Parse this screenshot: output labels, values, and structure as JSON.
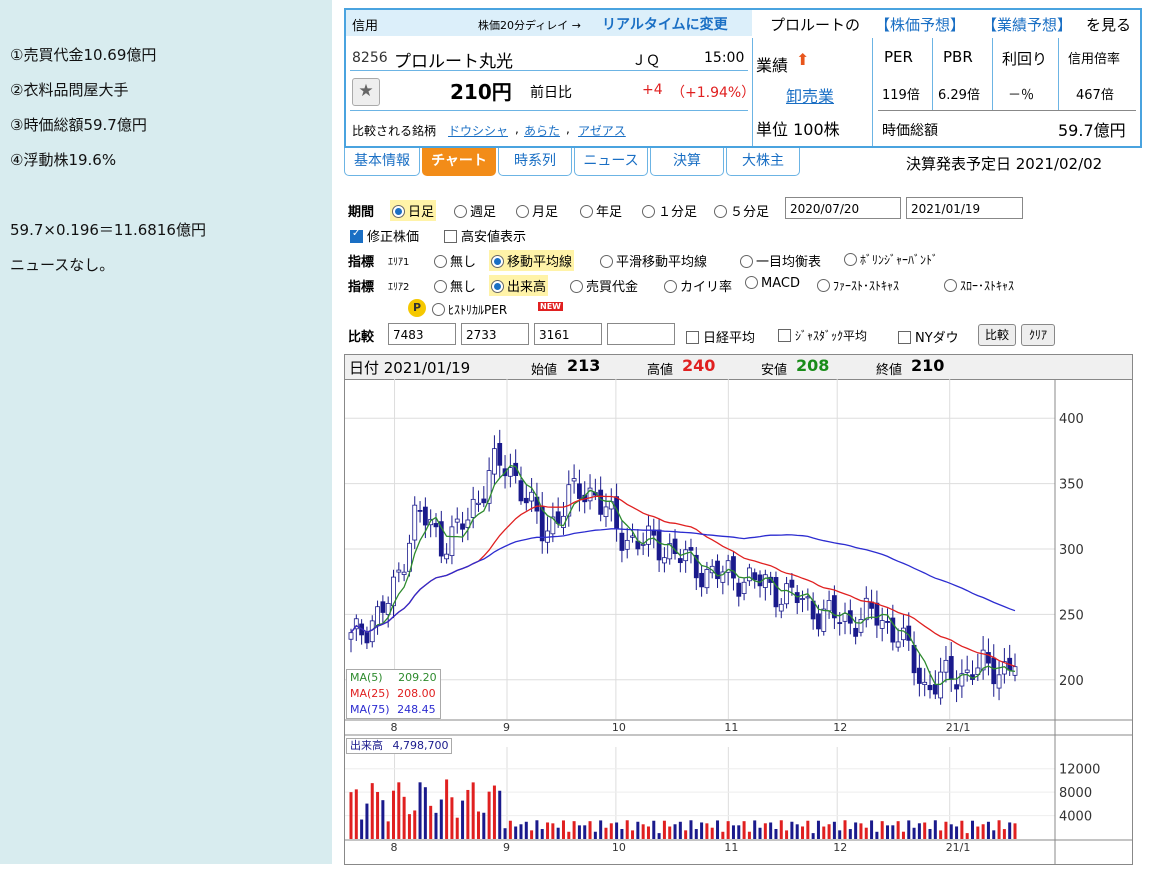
{
  "notes": [
    "①売買代金10.69億円",
    "②衣料品問屋大手",
    "③時価総額59.7億円",
    "④浮動株19.6%",
    "59.7×0.196＝11.6816億円",
    "ニュースなし。"
  ],
  "header": {
    "margin_label": "信用",
    "delay_text": "株価20分ディレイ →",
    "realtime_link": "リアルタイムに変更",
    "company_link_prefix": "プロルートの",
    "price_forecast_link": "【株価予想】",
    "earnings_forecast_link": "【業績予想】",
    "company_link_suffix": "を見る"
  },
  "stock": {
    "code": "8256",
    "name": "プロルート丸光",
    "market": "ＪＱ",
    "time": "15:00",
    "price": "210円",
    "change_label": "前日比",
    "change": "+4",
    "change_pct": "（+1.94%）",
    "compare_label": "比較される銘柄",
    "compare_stocks": [
      "ドウシシャ",
      "あらた",
      "アゼアス"
    ],
    "performance_label": "業績",
    "sector": "卸売業",
    "unit": "単位 100株",
    "metrics_headers": [
      "PER",
      "PBR",
      "利回り",
      "信用倍率"
    ],
    "metrics_values": [
      "119倍",
      "6.29倍",
      "－％",
      "467倍"
    ],
    "market_cap_label": "時価総額",
    "market_cap": "59.7億円"
  },
  "tabs": [
    "基本情報",
    "チャート",
    "時系列",
    "ニュース",
    "決算",
    "大株主"
  ],
  "earnings_date": "決算発表予定日 2021/02/02",
  "controls": {
    "period_label": "期間",
    "periods": [
      "日足",
      "週足",
      "月足",
      "年足",
      "１分足",
      "５分足"
    ],
    "date_from": "2020/07/20",
    "date_to": "2021/01/19",
    "adjusted": "修正株価",
    "high_low": "高安値表示",
    "indicator_label": "指標",
    "area1_label": "ｴﾘｱ1",
    "area1_opts": [
      "無し",
      "移動平均線",
      "平滑移動平均線",
      "一目均衡表",
      "ﾎﾞﾘﾝｼﾞｬｰﾊﾞﾝﾄﾞ"
    ],
    "area2_label": "ｴﾘｱ2",
    "area2_opts": [
      "無し",
      "出来高",
      "売買代金",
      "カイリ率",
      "MACD",
      "ﾌｧｰｽﾄ･ｽﾄｷｬｽ",
      "ｽﾛｰ･ｽﾄｷｬｽ"
    ],
    "historical_per": "ﾋｽﾄﾘｶﾙPER",
    "new_badge": "NEW",
    "p_badge": "P",
    "compare_label": "比較",
    "compare_codes": [
      "7483",
      "2733",
      "3161",
      ""
    ],
    "nikkei": "日経平均",
    "jasdaq": "ｼﾞｬｽﾀﾞｯｸ平均",
    "ny": "NYダウ",
    "compare_btn": "比較",
    "clear_btn": "ｸﾘｱ"
  },
  "ohlc": {
    "date_label": "日付 2021/01/19",
    "open_label": "始値",
    "open": "213",
    "high_label": "高値",
    "high": "240",
    "low_label": "安値",
    "low": "208",
    "close_label": "終値",
    "close": "210"
  },
  "ma_legend": [
    {
      "label": "MA(5)",
      "value": "209.20",
      "color": "#2e8b2e"
    },
    {
      "label": "MA(25)",
      "value": "208.00",
      "color": "#e02020"
    },
    {
      "label": "MA(75)",
      "value": "248.45",
      "color": "#2c2cd0"
    }
  ],
  "volume_legend": {
    "label": "出来高",
    "value": "4,798,700"
  },
  "colors": {
    "up": "#ffffff",
    "down": "#1a1a8c",
    "ma5": "#2e8b2e",
    "ma25": "#e02020",
    "ma75": "#2c2cd0",
    "vol_up": "#e02020",
    "vol_down": "#1a1a8c"
  },
  "chart_data": {
    "type": "candlestick",
    "title": "",
    "x_ticks": [
      "8",
      "9",
      "10",
      "11",
      "12",
      "21/1"
    ],
    "y_ticks": [
      200,
      250,
      300,
      350,
      400
    ],
    "ylim": [
      170,
      430
    ],
    "volume_ticks": [
      4000,
      8000,
      12000
    ],
    "volume_ylim": [
      0,
      14000
    ],
    "close_points": [
      {
        "x": "2020/07/20",
        "y": 230
      },
      {
        "x": "2020/07/31",
        "y": 260
      },
      {
        "x": "2020/08/07",
        "y": 330
      },
      {
        "x": "2020/08/14",
        "y": 305
      },
      {
        "x": "2020/08/21",
        "y": 320
      },
      {
        "x": "2020/08/28",
        "y": 365
      },
      {
        "x": "2020/09/04",
        "y": 355
      },
      {
        "x": "2020/09/11",
        "y": 310
      },
      {
        "x": "2020/09/18",
        "y": 340
      },
      {
        "x": "2020/09/25",
        "y": 345
      },
      {
        "x": "2020/10/02",
        "y": 310
      },
      {
        "x": "2020/10/09",
        "y": 305
      },
      {
        "x": "2020/10/16",
        "y": 300
      },
      {
        "x": "2020/10/23",
        "y": 285
      },
      {
        "x": "2020/10/30",
        "y": 280
      },
      {
        "x": "2020/11/06",
        "y": 278
      },
      {
        "x": "2020/11/13",
        "y": 270
      },
      {
        "x": "2020/11/20",
        "y": 262
      },
      {
        "x": "2020/11/27",
        "y": 250
      },
      {
        "x": "2020/12/04",
        "y": 245
      },
      {
        "x": "2020/12/11",
        "y": 250
      },
      {
        "x": "2020/12/18",
        "y": 235
      },
      {
        "x": "2020/12/25",
        "y": 195
      },
      {
        "x": "2021/01/08",
        "y": 208
      },
      {
        "x": "2021/01/19",
        "y": 210
      }
    ],
    "series": [
      {
        "name": "MA(5)",
        "last": 209.2
      },
      {
        "name": "MA(25)",
        "last": 208.0
      },
      {
        "name": "MA(75)",
        "last": 248.45
      }
    ]
  }
}
